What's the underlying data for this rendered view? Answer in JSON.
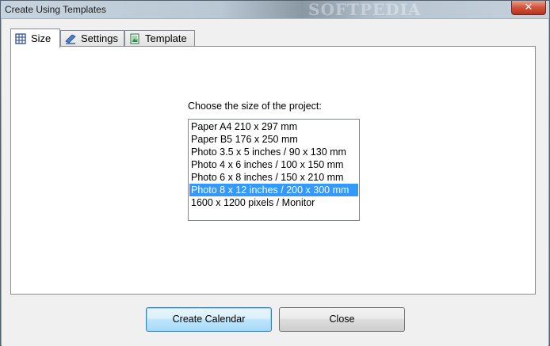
{
  "window": {
    "title": "Create Using Templates",
    "watermark": "SOFTPEDIA",
    "close_glyph": "✕"
  },
  "tabs": [
    {
      "label": "Size",
      "icon": "grid-icon",
      "active": true
    },
    {
      "label": "Settings",
      "icon": "pen-icon",
      "active": false
    },
    {
      "label": "Template",
      "icon": "picture-icon",
      "active": false
    }
  ],
  "size_panel": {
    "prompt": "Choose the size of the project:",
    "options": [
      "Paper A4 210 x 297 mm",
      "Paper B5 176 x 250 mm",
      "Photo 3.5 x 5 inches / 90 x 130 mm",
      "Photo 4 x 6 inches / 100 x 150 mm",
      "Photo 6 x 8 inches / 150 x 210 mm",
      "Photo 8 x 12 inches / 200 x 300 mm",
      "1600 x 1200 pixels / Monitor"
    ],
    "selected": "Photo 8 x 12 inches / 200 x 300 mm"
  },
  "buttons": {
    "create_label": "Create Calendar",
    "close_label": "Close"
  },
  "colors": {
    "selection": "#3399ff",
    "close_button": "#d2533b"
  }
}
